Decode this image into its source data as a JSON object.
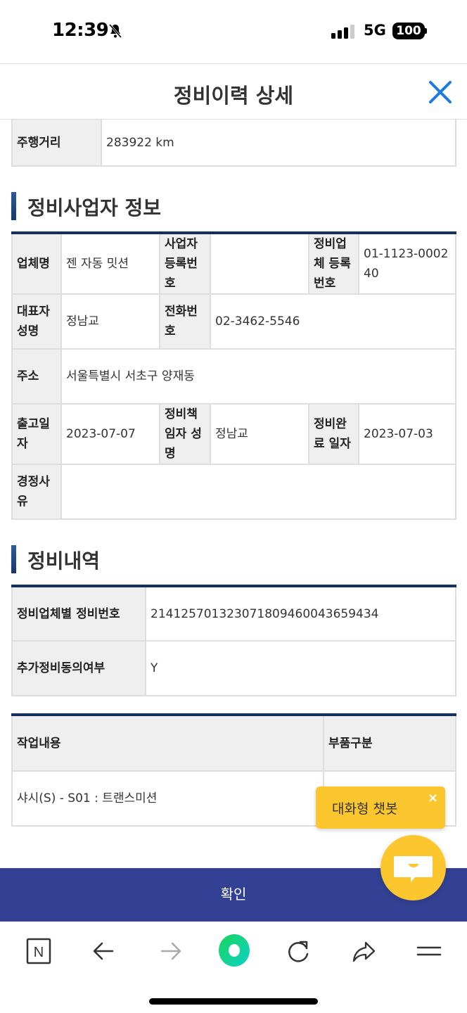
{
  "status_bar": {
    "time": "12:39",
    "network": "5G",
    "battery": "100",
    "icons": [
      "bell-slash-icon",
      "signal-icon",
      "battery-icon"
    ]
  },
  "header": {
    "title": "정비이력 상세",
    "close_icon": "close-icon",
    "accent_color": "#1f7ae0"
  },
  "vehicle": {
    "mileage_label": "주행거리",
    "mileage_value": "283922 km"
  },
  "business_section": {
    "title": "정비사업자 정보",
    "company_name_label": "업체명",
    "company_name_value": "젠 자동 밋션",
    "biz_reg_no_label": "사업자 등록번호",
    "biz_reg_no_value": "",
    "shop_reg_no_label": "정비업체 등록번호",
    "shop_reg_no_value": "01-1123-000240",
    "rep_name_label": "대표자 성명",
    "rep_name_value": "정남교",
    "phone_label": "전화번호",
    "phone_value": "02-3462-5546",
    "address_label": "주소",
    "address_value": "서울특별시 서초구 양재동",
    "release_date_label": "출고일자",
    "release_date_value": "2023-07-07",
    "manager_label": "정비책임자 성명",
    "manager_value": "정남교",
    "complete_date_label": "정비완료 일자",
    "complete_date_value": "2023-07-03",
    "minor_reason_label": "경정사유",
    "minor_reason_value": ""
  },
  "history_section": {
    "title": "정비내역",
    "service_no_label": "정비업체별 정비번호",
    "service_no_value": "214125701323071809460043659434",
    "extra_consent_label": "추가정비동의여부",
    "extra_consent_value": "Y"
  },
  "work_table": {
    "columns": [
      "작업내용",
      "부품구분"
    ],
    "rows": [
      [
        "샤시(S) - S01 : 트랜스미션",
        ""
      ]
    ]
  },
  "chatbot": {
    "tooltip": "대화형 챗봇",
    "close": "×",
    "color": "#fcc62e"
  },
  "confirm": {
    "label": "확인",
    "color": "#334194"
  },
  "browser_toolbar": {
    "items": [
      "naver-n-icon",
      "back-arrow-icon",
      "forward-arrow-icon",
      "green-dot-icon",
      "reload-icon",
      "share-icon",
      "menu-icon"
    ]
  }
}
